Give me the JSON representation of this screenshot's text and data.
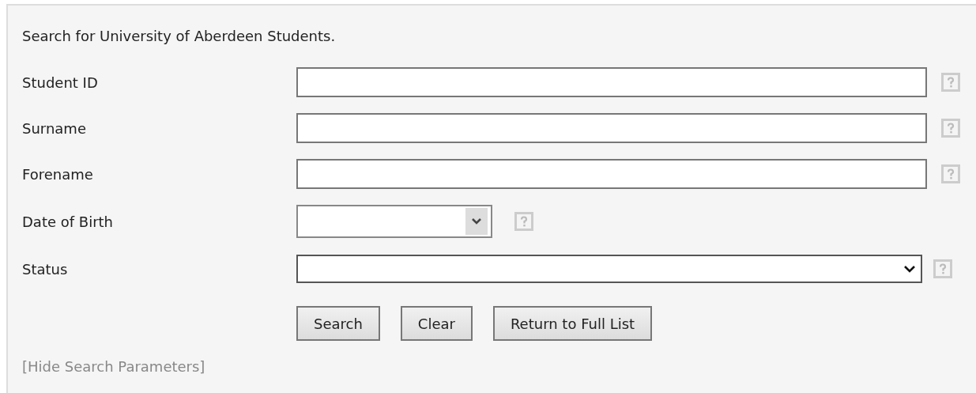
{
  "intro": "Search for University of Aberdeen Students.",
  "fields": [
    {
      "label": "Student ID",
      "kind": "text"
    },
    {
      "label": "Surname",
      "kind": "text"
    },
    {
      "label": "Forename",
      "kind": "text"
    },
    {
      "label": "Date of Birth",
      "kind": "date-select"
    },
    {
      "label": "Status",
      "kind": "select"
    }
  ],
  "buttons": [
    "Search",
    "Clear",
    "Return to Full List"
  ],
  "toggle_link": "[Hide Search Parameters]"
}
